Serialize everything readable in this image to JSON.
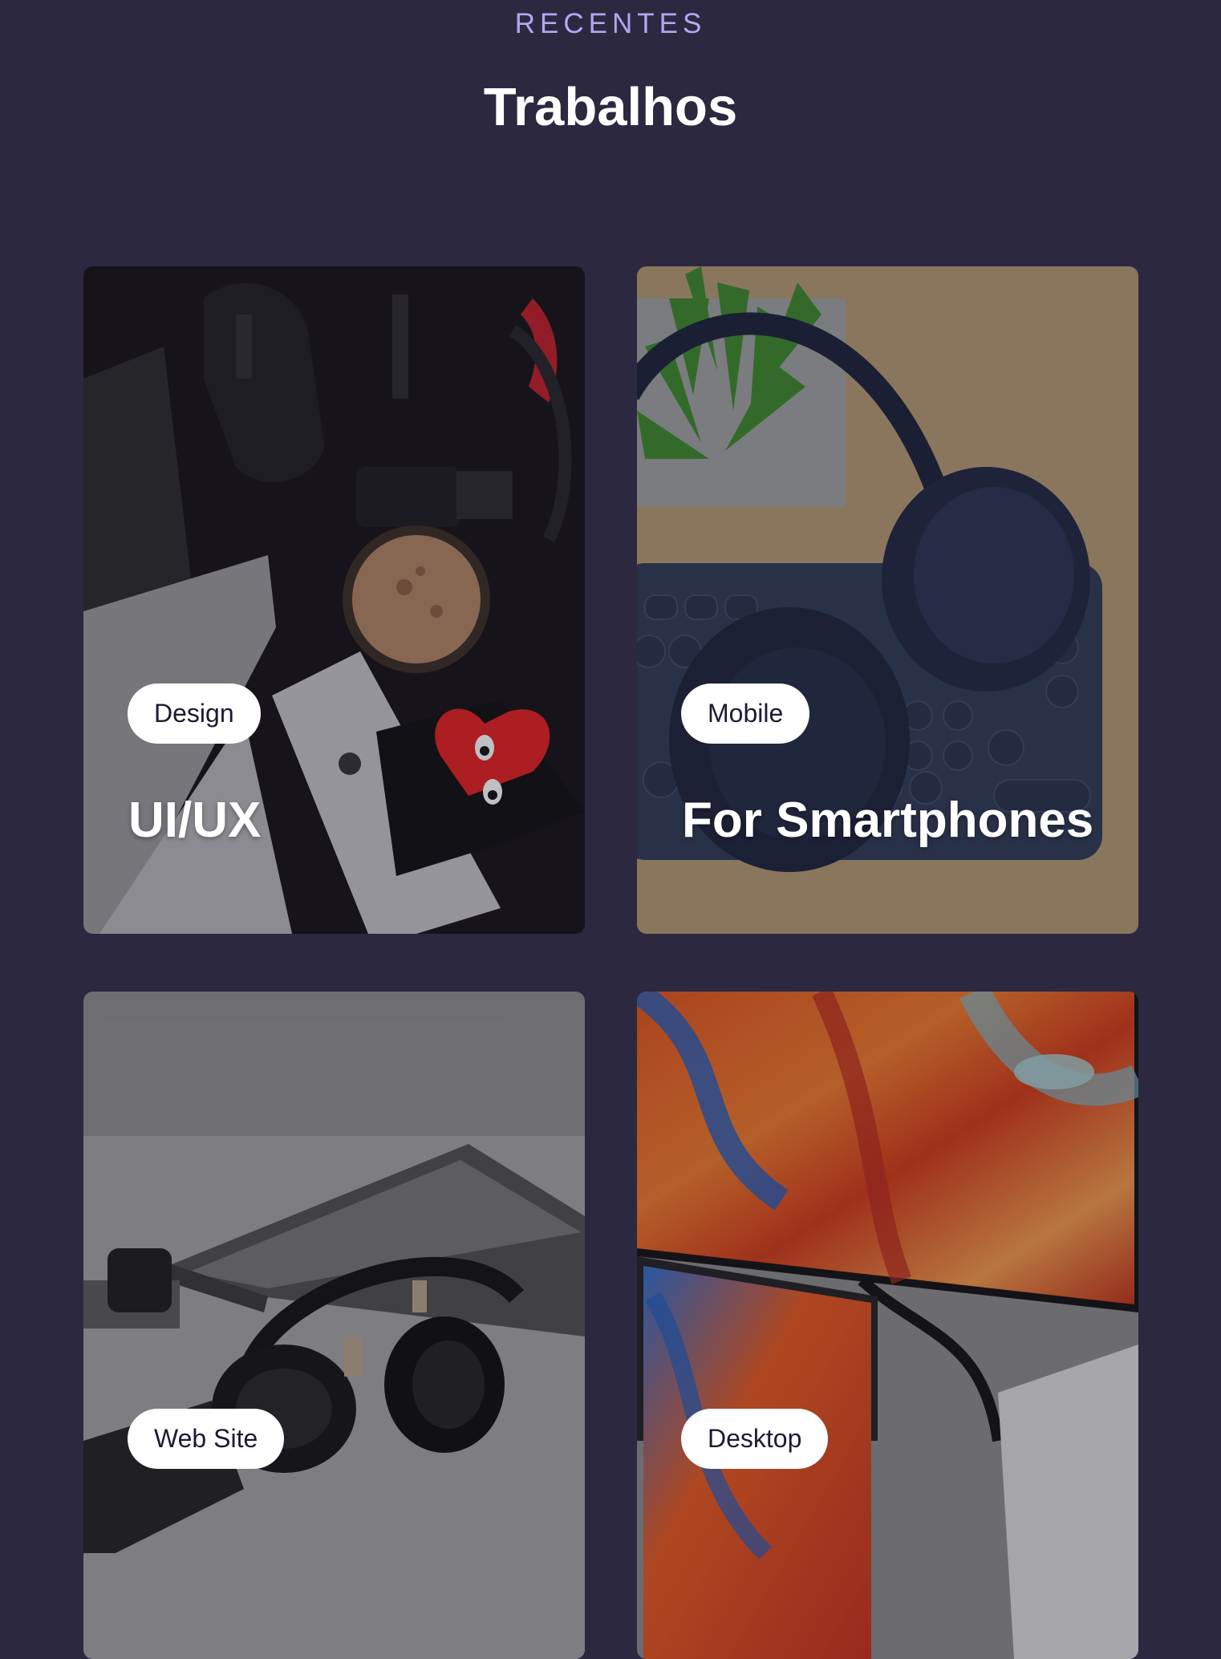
{
  "section": {
    "eyebrow": "RECENTES",
    "title": "Trabalhos"
  },
  "colors": {
    "background": "#2c2840",
    "eyebrow": "#b3a7f0",
    "tag_bg": "#ffffff",
    "tag_text": "#1e1a33"
  },
  "projects": [
    {
      "tag": "Design",
      "title": "UI/UX",
      "image": "dark desk with mouse, coffee and phone"
    },
    {
      "tag": "Mobile",
      "title": "For Smartphones",
      "image": "headphones on keyboard with plant"
    },
    {
      "tag": "Web Site",
      "title": "",
      "image": "laptop with headphones and watch"
    },
    {
      "tag": "Desktop",
      "title": "",
      "image": "monitor and laptop with colorful wallpaper"
    }
  ]
}
